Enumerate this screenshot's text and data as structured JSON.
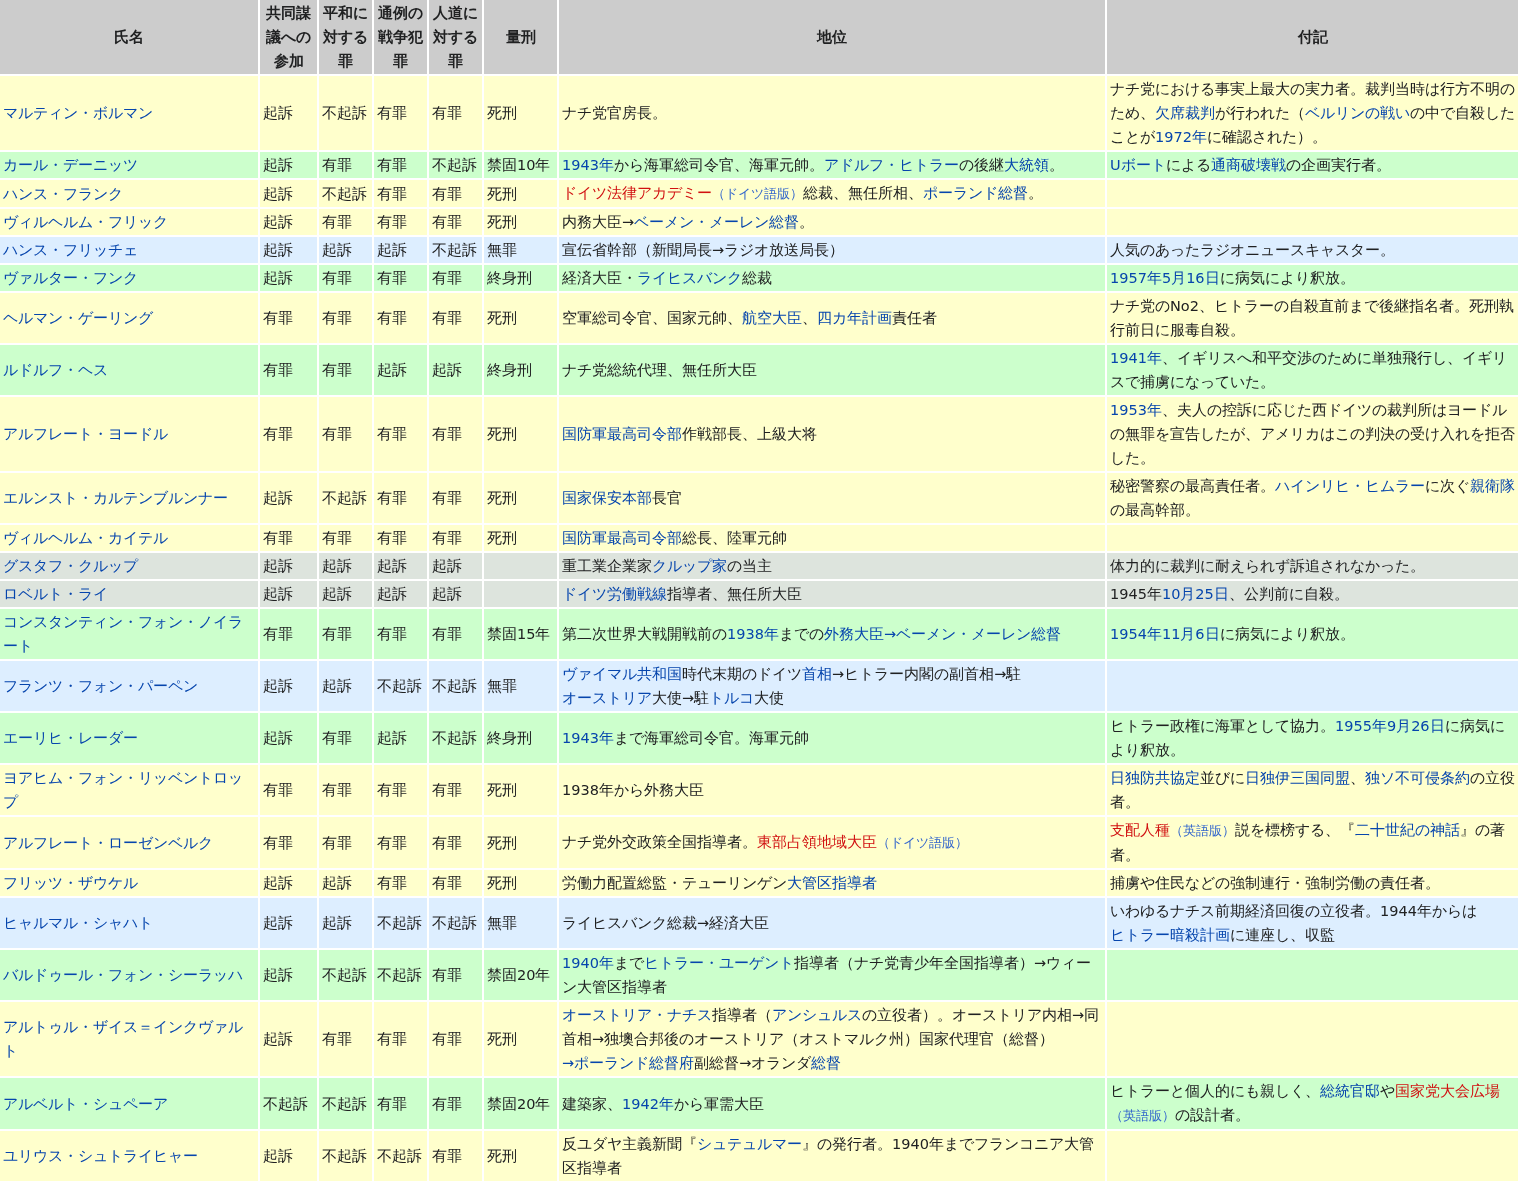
{
  "table": {
    "columns": [
      "氏名",
      "共同謀議への参加",
      "平和に対する罪",
      "通例の戦争犯罪",
      "人道に対する罪",
      "量刑",
      "地位",
      "付記"
    ],
    "rows": [
      {
        "color": "#ffffcc",
        "name": "マルティン・ボルマン",
        "counts": [
          "起訴",
          "不起訴",
          "有罪",
          "有罪"
        ],
        "sentence": "死刑",
        "position": [
          {
            "kind": "text",
            "text": "ナチ党官房長。"
          }
        ],
        "note": [
          {
            "kind": "text",
            "text": "ナチ党における事実上最大の実力者。裁判当時は行方不明のため、"
          },
          {
            "kind": "link",
            "text": "欠席裁判"
          },
          {
            "kind": "text",
            "text": "が行われた（"
          },
          {
            "kind": "link",
            "text": "ベルリンの戦い"
          },
          {
            "kind": "text",
            "text": "の中で自殺したことが"
          },
          {
            "kind": "link",
            "text": "1972年"
          },
          {
            "kind": "text",
            "text": "に確認された）。"
          }
        ]
      },
      {
        "color": "#ccffcc",
        "name": "カール・デーニッツ",
        "counts": [
          "起訴",
          "有罪",
          "有罪",
          "不起訴"
        ],
        "sentence": "禁固10年",
        "position": [
          {
            "kind": "link",
            "text": "1943年"
          },
          {
            "kind": "text",
            "text": "から海軍総司令官、海軍元帥。"
          },
          {
            "kind": "link",
            "text": "アドルフ・ヒトラー"
          },
          {
            "kind": "text",
            "text": "の後継"
          },
          {
            "kind": "link",
            "text": "大統領"
          },
          {
            "kind": "text",
            "text": "。"
          }
        ],
        "note": [
          {
            "kind": "link",
            "text": "Uボート"
          },
          {
            "kind": "text",
            "text": "による"
          },
          {
            "kind": "link",
            "text": "通商破壊戦"
          },
          {
            "kind": "text",
            "text": "の企画実行者。"
          }
        ]
      },
      {
        "color": "#ffffcc",
        "name": "ハンス・フランク",
        "counts": [
          "起訴",
          "不起訴",
          "有罪",
          "有罪"
        ],
        "sentence": "死刑",
        "position": [
          {
            "kind": "redlink",
            "text": "ドイツ法律アカデミー"
          },
          {
            "kind": "langlink",
            "text": "（ドイツ語版）"
          },
          {
            "kind": "text",
            "text": "総裁、無任所相、"
          },
          {
            "kind": "link",
            "text": "ポーランド総督"
          },
          {
            "kind": "text",
            "text": "。"
          }
        ],
        "note": []
      },
      {
        "color": "#ffffcc",
        "name": "ヴィルヘルム・フリック",
        "counts": [
          "起訴",
          "有罪",
          "有罪",
          "有罪"
        ],
        "sentence": "死刑",
        "position": [
          {
            "kind": "text",
            "text": "内務大臣→"
          },
          {
            "kind": "link",
            "text": "ベーメン・メーレン総督"
          },
          {
            "kind": "text",
            "text": "。"
          }
        ],
        "note": []
      },
      {
        "color": "#ddeeff",
        "name": "ハンス・フリッチェ",
        "counts": [
          "起訴",
          "起訴",
          "起訴",
          "不起訴"
        ],
        "sentence": "無罪",
        "position": [
          {
            "kind": "text",
            "text": "宣伝省幹部（新聞局長→ラジオ放送局長）"
          }
        ],
        "note": [
          {
            "kind": "text",
            "text": "人気のあったラジオニュースキャスター。"
          }
        ]
      },
      {
        "color": "#ccffcc",
        "name": "ヴァルター・フンク",
        "counts": [
          "起訴",
          "有罪",
          "有罪",
          "有罪"
        ],
        "sentence": "終身刑",
        "position": [
          {
            "kind": "text",
            "text": "経済大臣・"
          },
          {
            "kind": "link",
            "text": "ライヒスバンク"
          },
          {
            "kind": "text",
            "text": "総裁"
          }
        ],
        "note": [
          {
            "kind": "link",
            "text": "1957年5月16日"
          },
          {
            "kind": "text",
            "text": "に病気により釈放。"
          }
        ]
      },
      {
        "color": "#ffffcc",
        "name": "ヘルマン・ゲーリング",
        "counts": [
          "有罪",
          "有罪",
          "有罪",
          "有罪"
        ],
        "sentence": "死刑",
        "position": [
          {
            "kind": "text",
            "text": "空軍総司令官、国家元帥、"
          },
          {
            "kind": "link",
            "text": "航空大臣"
          },
          {
            "kind": "text",
            "text": "、"
          },
          {
            "kind": "link",
            "text": "四カ年計画"
          },
          {
            "kind": "text",
            "text": "責任者"
          }
        ],
        "note": [
          {
            "kind": "text",
            "text": "ナチ党のNo2、ヒトラーの自殺直前まで後継指名者。死刑執行前日に服毒自殺。"
          }
        ]
      },
      {
        "color": "#ccffcc",
        "name": "ルドルフ・ヘス",
        "counts": [
          "有罪",
          "有罪",
          "起訴",
          "起訴"
        ],
        "sentence": "終身刑",
        "position": [
          {
            "kind": "text",
            "text": "ナチ党総統代理、無任所大臣"
          }
        ],
        "note": [
          {
            "kind": "link",
            "text": "1941年"
          },
          {
            "kind": "text",
            "text": "、イギリスへ和平交渉のために単独飛行し、イギリスで捕虜になっていた。"
          }
        ]
      },
      {
        "color": "#ffffcc",
        "name": "アルフレート・ヨードル",
        "counts": [
          "有罪",
          "有罪",
          "有罪",
          "有罪"
        ],
        "sentence": "死刑",
        "position": [
          {
            "kind": "link",
            "text": "国防軍最高司令部"
          },
          {
            "kind": "text",
            "text": "作戦部長、上級大将"
          }
        ],
        "note": [
          {
            "kind": "link",
            "text": "1953年"
          },
          {
            "kind": "text",
            "text": "、夫人の控訴に応じた西ドイツの裁判所はヨードルの無罪を宣告したが、アメリカはこの判決の受け入れを拒否した。"
          }
        ]
      },
      {
        "color": "#ffffcc",
        "name": "エルンスト・カルテンブルンナー",
        "counts": [
          "起訴",
          "不起訴",
          "有罪",
          "有罪"
        ],
        "sentence": "死刑",
        "position": [
          {
            "kind": "link",
            "text": "国家保安本部"
          },
          {
            "kind": "text",
            "text": "長官"
          }
        ],
        "note": [
          {
            "kind": "text",
            "text": "秘密警察の最高責任者。"
          },
          {
            "kind": "link",
            "text": "ハインリヒ・ヒムラー"
          },
          {
            "kind": "text",
            "text": "に次ぐ"
          },
          {
            "kind": "link",
            "text": "親衛隊"
          },
          {
            "kind": "text",
            "text": "の最高幹部。"
          }
        ]
      },
      {
        "color": "#ffffcc",
        "name": "ヴィルヘルム・カイテル",
        "counts": [
          "有罪",
          "有罪",
          "有罪",
          "有罪"
        ],
        "sentence": "死刑",
        "position": [
          {
            "kind": "link",
            "text": "国防軍最高司令部"
          },
          {
            "kind": "text",
            "text": "総長、陸軍元帥"
          }
        ],
        "note": []
      },
      {
        "color": "#dde4dd",
        "name": "グスタフ・クルップ",
        "counts": [
          "起訴",
          "起訴",
          "起訴",
          "起訴"
        ],
        "sentence": "",
        "position": [
          {
            "kind": "text",
            "text": "重工業企業家"
          },
          {
            "kind": "link",
            "text": "クルップ家"
          },
          {
            "kind": "text",
            "text": "の当主"
          }
        ],
        "note": [
          {
            "kind": "text",
            "text": "体力的に裁判に耐えられず訴追されなかった。"
          }
        ]
      },
      {
        "color": "#dde4dd",
        "name": "ロベルト・ライ",
        "counts": [
          "起訴",
          "起訴",
          "起訴",
          "起訴"
        ],
        "sentence": "",
        "position": [
          {
            "kind": "link",
            "text": "ドイツ労働戦線"
          },
          {
            "kind": "text",
            "text": "指導者、無任所大臣"
          }
        ],
        "note": [
          {
            "kind": "text",
            "text": "1945年"
          },
          {
            "kind": "link",
            "text": "10月25日"
          },
          {
            "kind": "text",
            "text": "、公判前に自殺。"
          }
        ]
      },
      {
        "color": "#ccffcc",
        "name": "コンスタンティン・フォン・ノイラート",
        "counts": [
          "有罪",
          "有罪",
          "有罪",
          "有罪"
        ],
        "sentence": "禁固15年",
        "position": [
          {
            "kind": "text",
            "text": "第二次世界大戦開戦前の"
          },
          {
            "kind": "link",
            "text": "1938年"
          },
          {
            "kind": "text",
            "text": "までの"
          },
          {
            "kind": "link",
            "text": "外務大臣"
          },
          {
            "kind": "link",
            "text": "→ベーメン・メーレン総督"
          }
        ],
        "note": [
          {
            "kind": "link",
            "text": "1954年11月6日"
          },
          {
            "kind": "text",
            "text": "に病気により釈放。"
          }
        ]
      },
      {
        "color": "#ddeeff",
        "name": "フランツ・フォン・パーペン",
        "counts": [
          "起訴",
          "起訴",
          "不起訴",
          "不起訴"
        ],
        "sentence": "無罪",
        "position": [
          {
            "kind": "link",
            "text": "ヴァイマル共和国"
          },
          {
            "kind": "text",
            "text": "時代末期のドイツ"
          },
          {
            "kind": "link",
            "text": "首相"
          },
          {
            "kind": "text",
            "text": "→ヒトラー内閣の副首相→駐"
          },
          {
            "kind": "link",
            "text": "オーストリア"
          },
          {
            "kind": "text",
            "text": "大使→駐"
          },
          {
            "kind": "link",
            "text": "トルコ"
          },
          {
            "kind": "text",
            "text": "大使"
          }
        ],
        "note": []
      },
      {
        "color": "#ccffcc",
        "name": "エーリヒ・レーダー",
        "counts": [
          "起訴",
          "有罪",
          "起訴",
          "不起訴"
        ],
        "sentence": "終身刑",
        "position": [
          {
            "kind": "link",
            "text": "1943年"
          },
          {
            "kind": "text",
            "text": "まで海軍総司令官。海軍元帥"
          }
        ],
        "note": [
          {
            "kind": "text",
            "text": "ヒトラー政権に海軍として協力。"
          },
          {
            "kind": "link",
            "text": "1955年9月26日"
          },
          {
            "kind": "text",
            "text": "に病気により釈放。"
          }
        ]
      },
      {
        "color": "#ffffcc",
        "name": "ヨアヒム・フォン・リッベントロップ",
        "counts": [
          "有罪",
          "有罪",
          "有罪",
          "有罪"
        ],
        "sentence": "死刑",
        "position": [
          {
            "kind": "text",
            "text": "1938年から外務大臣"
          }
        ],
        "note": [
          {
            "kind": "link",
            "text": "日独防共協定"
          },
          {
            "kind": "text",
            "text": "並びに"
          },
          {
            "kind": "link",
            "text": "日独伊三国同盟"
          },
          {
            "kind": "text",
            "text": "、"
          },
          {
            "kind": "link",
            "text": "独ソ不可侵条約"
          },
          {
            "kind": "text",
            "text": "の立役者。"
          }
        ]
      },
      {
        "color": "#ffffcc",
        "name": "アルフレート・ローゼンベルク",
        "counts": [
          "有罪",
          "有罪",
          "有罪",
          "有罪"
        ],
        "sentence": "死刑",
        "position": [
          {
            "kind": "text",
            "text": "ナチ党外交政策全国指導者。"
          },
          {
            "kind": "redlink",
            "text": "東部占領地域大臣"
          },
          {
            "kind": "langlink",
            "text": "（ドイツ語版）"
          }
        ],
        "note": [
          {
            "kind": "redlink",
            "text": "支配人種"
          },
          {
            "kind": "langlink",
            "text": "（英語版）"
          },
          {
            "kind": "text",
            "text": "説を標榜する、『"
          },
          {
            "kind": "link",
            "text": "二十世紀の神話"
          },
          {
            "kind": "text",
            "text": "』の著者。"
          }
        ]
      },
      {
        "color": "#ffffcc",
        "name": "フリッツ・ザウケル",
        "counts": [
          "起訴",
          "起訴",
          "有罪",
          "有罪"
        ],
        "sentence": "死刑",
        "position": [
          {
            "kind": "text",
            "text": "労働力配置総監・テューリンゲン"
          },
          {
            "kind": "link",
            "text": "大管区指導者"
          }
        ],
        "note": [
          {
            "kind": "text",
            "text": "捕虜や住民などの強制連行・強制労働の責任者。"
          }
        ]
      },
      {
        "color": "#ddeeff",
        "name": "ヒャルマル・シャハト",
        "counts": [
          "起訴",
          "起訴",
          "不起訴",
          "不起訴"
        ],
        "sentence": "無罪",
        "position": [
          {
            "kind": "text",
            "text": "ライヒスバンク総裁→経済大臣"
          }
        ],
        "note": [
          {
            "kind": "text",
            "text": "いわゆるナチス前期経済回復の立役者。1944年からは"
          },
          {
            "kind": "link",
            "text": "ヒトラー暗殺計画"
          },
          {
            "kind": "text",
            "text": "に連座し、収監"
          }
        ]
      },
      {
        "color": "#ccffcc",
        "name": "バルドゥール・フォン・シーラッハ",
        "counts": [
          "起訴",
          "不起訴",
          "不起訴",
          "有罪"
        ],
        "sentence": "禁固20年",
        "position": [
          {
            "kind": "link",
            "text": "1940年"
          },
          {
            "kind": "text",
            "text": "まで"
          },
          {
            "kind": "link",
            "text": "ヒトラー・ユーゲント"
          },
          {
            "kind": "text",
            "text": "指導者（ナチ党青少年全国指導者）→ウィーン大管区指導者"
          }
        ],
        "note": []
      },
      {
        "color": "#ffffcc",
        "name": "アルトゥル・ザイス＝インクヴァルト",
        "counts": [
          "起訴",
          "有罪",
          "有罪",
          "有罪"
        ],
        "sentence": "死刑",
        "position": [
          {
            "kind": "link",
            "text": "オーストリア・ナチス"
          },
          {
            "kind": "text",
            "text": "指導者（"
          },
          {
            "kind": "link",
            "text": "アンシュルス"
          },
          {
            "kind": "text",
            "text": "の立役者）。オーストリア内相→同首相→独墺合邦後のオーストリア（オストマルク州）国家代理官（総督）"
          },
          {
            "kind": "link",
            "text": "→ポーランド総督府"
          },
          {
            "kind": "text",
            "text": "副総督→オランダ"
          },
          {
            "kind": "link",
            "text": "総督"
          }
        ],
        "note": []
      },
      {
        "color": "#ccffcc",
        "name": "アルベルト・シュペーア",
        "counts": [
          "不起訴",
          "不起訴",
          "有罪",
          "有罪"
        ],
        "sentence": "禁固20年",
        "position": [
          {
            "kind": "text",
            "text": "建築家、"
          },
          {
            "kind": "link",
            "text": "1942年"
          },
          {
            "kind": "text",
            "text": "から軍需大臣"
          }
        ],
        "note": [
          {
            "kind": "text",
            "text": "ヒトラーと個人的にも親しく、"
          },
          {
            "kind": "link",
            "text": "総統官邸"
          },
          {
            "kind": "text",
            "text": "や"
          },
          {
            "kind": "redlink",
            "text": "国家党大会広場"
          },
          {
            "kind": "langlink",
            "text": "（英語版）"
          },
          {
            "kind": "text",
            "text": "の設計者。"
          }
        ]
      },
      {
        "color": "#ffffcc",
        "name": "ユリウス・シュトライヒャー",
        "counts": [
          "起訴",
          "不起訴",
          "不起訴",
          "有罪"
        ],
        "sentence": "死刑",
        "position": [
          {
            "kind": "text",
            "text": "反ユダヤ主義新聞『"
          },
          {
            "kind": "link",
            "text": "シュテュルマー"
          },
          {
            "kind": "text",
            "text": "』の発行者。1940年までフランコニア大管区指導者"
          }
        ],
        "note": []
      }
    ]
  }
}
